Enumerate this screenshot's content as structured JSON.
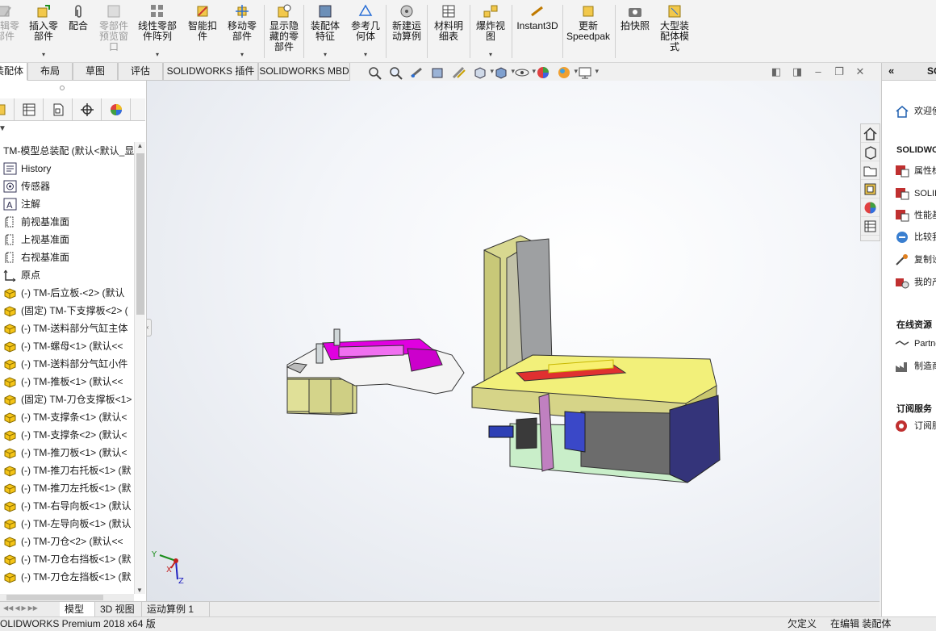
{
  "ribbon": {
    "buttons": [
      {
        "label": "编辑零\n部件",
        "disabled": true
      },
      {
        "label": "插入零\n部件"
      },
      {
        "label": "配合"
      },
      {
        "label": "零部件\n预览窗\n口",
        "disabled": true
      },
      {
        "label": "线性零部\n件阵列"
      },
      {
        "label": "智能扣\n件"
      },
      {
        "label": "移动零\n部件"
      },
      {
        "label": "显示隐\n藏的零\n部件"
      },
      {
        "label": "装配体\n特征"
      },
      {
        "label": "参考几\n何体"
      },
      {
        "label": "新建运\n动算例"
      },
      {
        "label": "材料明\n细表"
      },
      {
        "label": "爆炸视\n图"
      },
      {
        "label": "Instant3D"
      },
      {
        "label": "更新\nSpeedpak"
      },
      {
        "label": "拍快照"
      },
      {
        "label": "大型装\n配体模\n式"
      }
    ]
  },
  "tabs": [
    "装配体",
    "布局",
    "草图",
    "评估",
    "SOLIDWORKS 插件",
    "SOLIDWORKS MBD"
  ],
  "tree": {
    "root": "TM-模型总装配 (默认<默认_显",
    "items": [
      {
        "label": "History",
        "icon": "history-icon"
      },
      {
        "label": "传感器",
        "icon": "sensor-icon"
      },
      {
        "label": "注解",
        "icon": "annotation-icon"
      },
      {
        "label": "前视基准面",
        "icon": "plane-icon"
      },
      {
        "label": "上视基准面",
        "icon": "plane-icon"
      },
      {
        "label": "右视基准面",
        "icon": "plane-icon"
      },
      {
        "label": "原点",
        "icon": "origin-icon"
      },
      {
        "label": "(-) TM-后立板-<2> (默认",
        "icon": "part-icon"
      },
      {
        "label": "(固定) TM-下支撑板<2> (",
        "icon": "part-icon"
      },
      {
        "label": "(-) TM-送料部分气缸主体",
        "icon": "part-icon"
      },
      {
        "label": "(-) TM-螺母<1> (默认<<",
        "icon": "part-icon"
      },
      {
        "label": "(-) TM-送料部分气缸小件",
        "icon": "part-icon"
      },
      {
        "label": "(-) TM-推板<1> (默认<<",
        "icon": "part-icon"
      },
      {
        "label": "(固定) TM-刀仓支撑板<1>",
        "icon": "part-icon"
      },
      {
        "label": "(-) TM-支撑条<1> (默认<",
        "icon": "part-icon"
      },
      {
        "label": "(-) TM-支撑条<2> (默认<",
        "icon": "part-icon"
      },
      {
        "label": "(-) TM-推刀板<1> (默认<",
        "icon": "part-icon"
      },
      {
        "label": "(-) TM-推刀右托板<1> (默",
        "icon": "part-icon"
      },
      {
        "label": "(-) TM-推刀左托板<1> (默",
        "icon": "part-icon"
      },
      {
        "label": "(-) TM-右导向板<1> (默认",
        "icon": "part-icon"
      },
      {
        "label": "(-) TM-左导向板<1> (默认",
        "icon": "part-icon"
      },
      {
        "label": "(-) TM-刀仓<2> (默认<<",
        "icon": "part-icon"
      },
      {
        "label": "(-) TM-刀仓右挡板<1> (默",
        "icon": "part-icon"
      },
      {
        "label": "(-) TM-刀仓左挡板<1> (默",
        "icon": "part-icon"
      }
    ]
  },
  "bottom_tabs": [
    "模型",
    "3D 视图",
    "运动算例 1"
  ],
  "status": {
    "left": "SOLIDWORKS Premium 2018 x64 版",
    "undefined": "欠定义",
    "editing": "在编辑 装配体"
  },
  "taskpane": {
    "title": "SO",
    "welcome": "欢迎使",
    "section1": "SOLIDWO",
    "items1": [
      "属性标",
      "SOLID",
      "性能基",
      "比较我",
      "复制设",
      "我的产"
    ],
    "section2": "在线资源",
    "items2": [
      "Partne",
      "制造商"
    ],
    "section3": "订阅服务",
    "items3": [
      "订阅服"
    ]
  },
  "triad": {
    "x": "X",
    "y": "Y",
    "z": "Z"
  },
  "colors": {
    "accent": "#0b66c3",
    "magenta": "#e000e0",
    "yellow": "#f2f07a",
    "olive": "#d8d890"
  }
}
